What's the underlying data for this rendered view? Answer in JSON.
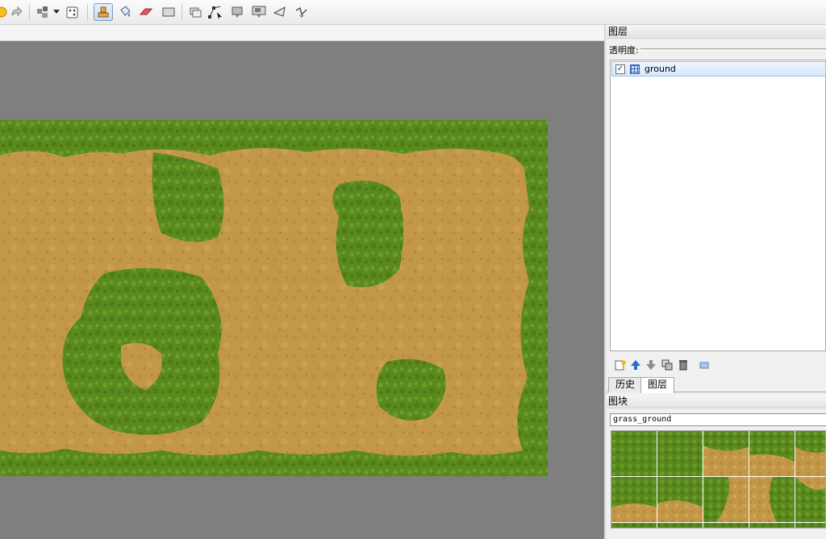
{
  "toolbar": {
    "icons": [
      "undo-icon",
      "redo-icon",
      "stamp-random-icon",
      "dropdown-arrow-icon",
      "dice-icon",
      "stamp-brush-icon",
      "bucket-fill-icon",
      "eraser-icon",
      "rect-select-icon",
      "object-select-icon",
      "object-edit-icon",
      "rect-object-icon",
      "image-object-icon",
      "polygon-icon",
      "polyline-icon"
    ],
    "active_tool": "stamp-brush-icon"
  },
  "layers_panel": {
    "title": "图层",
    "opacity_label": "透明度:",
    "layers": [
      {
        "name": "ground",
        "visible": true,
        "selected": true
      }
    ]
  },
  "tabs": [
    "历史",
    "图层"
  ],
  "active_tab": "图层",
  "tilesets_panel": {
    "title": "图块",
    "selected_tileset": "grass_ground"
  },
  "colors": {
    "canvas_bg": "#7f7f7f",
    "grass": "#5a8a1e",
    "dirt": "#c29848",
    "selection": "#d6e8fb"
  }
}
